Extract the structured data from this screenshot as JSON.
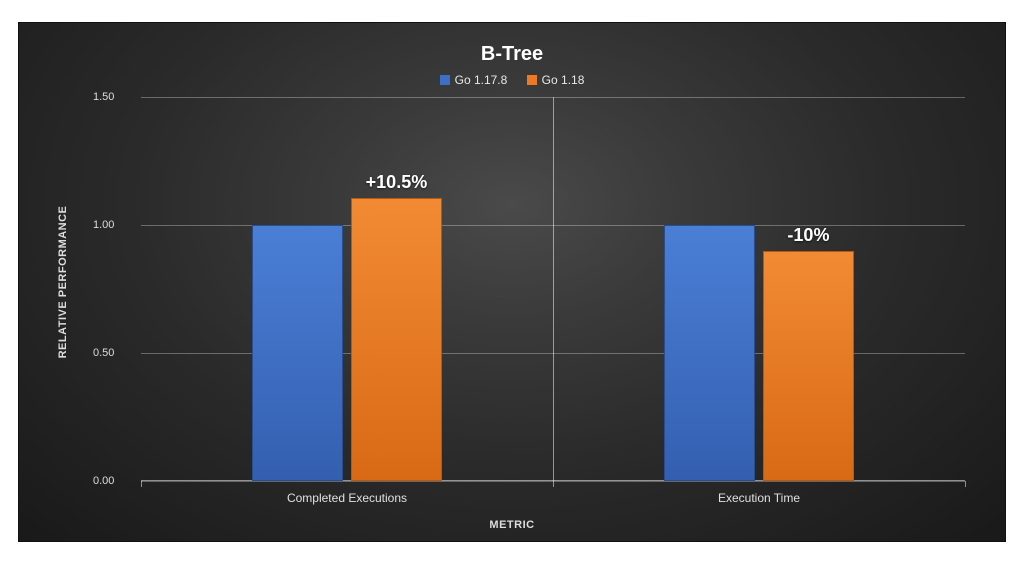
{
  "chart_data": {
    "type": "bar",
    "title": "B-Tree",
    "xlabel": "METRIC",
    "ylabel": "RELATIVE PERFORMANCE",
    "ylim": [
      0.0,
      1.5
    ],
    "yticks": [
      "0.00",
      "0.50",
      "1.00",
      "1.50"
    ],
    "categories": [
      "Completed Executions",
      "Execution Time"
    ],
    "series": [
      {
        "name": "Go 1.17.8",
        "color": "#3d6fc7",
        "values": [
          1.0,
          1.0
        ]
      },
      {
        "name": "Go 1.18",
        "color": "#ea7a23",
        "values": [
          1.105,
          0.9
        ]
      }
    ],
    "annotations": [
      {
        "text": "+10.5%",
        "category_index": 0,
        "series_index": 1
      },
      {
        "text": "-10%",
        "category_index": 1,
        "series_index": 1
      }
    ]
  }
}
